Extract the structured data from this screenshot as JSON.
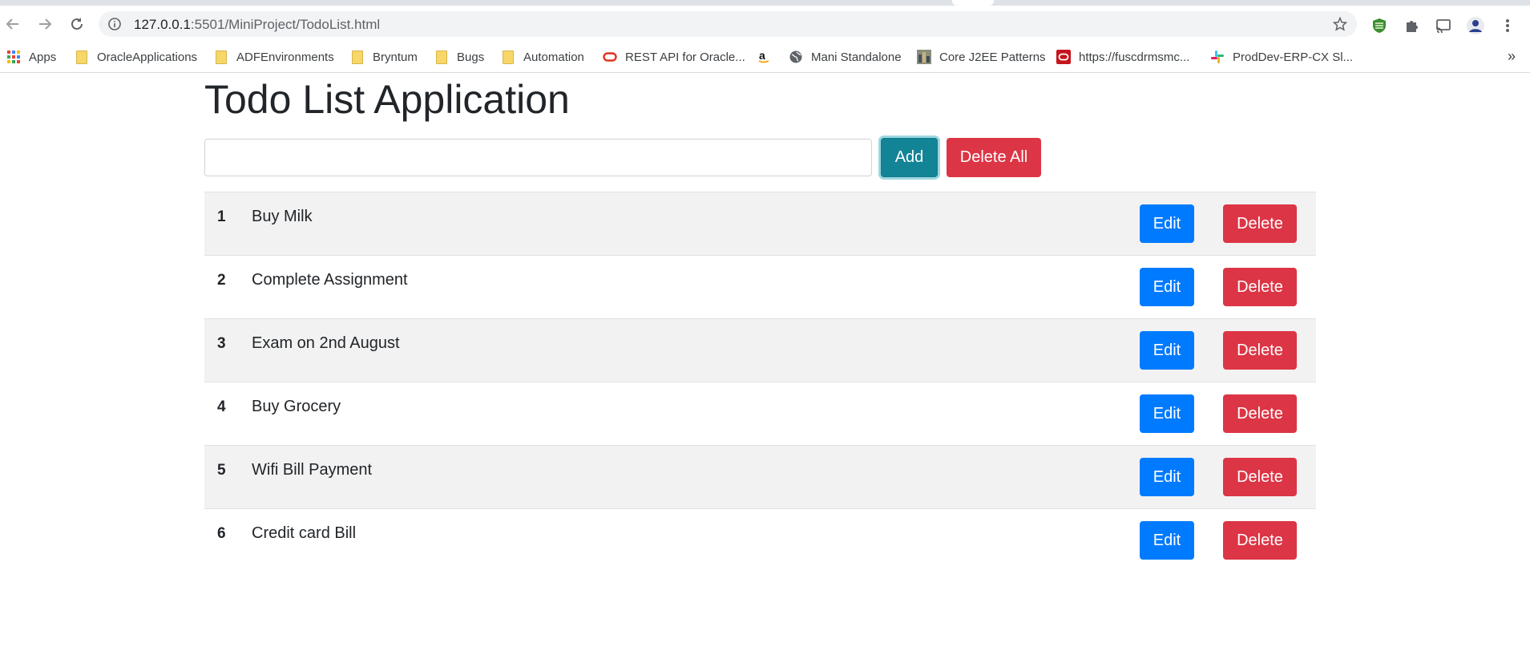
{
  "browser": {
    "url_host": "127.0.0.1",
    "url_rest": ":5501/MiniProject/TodoList.html",
    "bookmarks": [
      {
        "label": "Apps",
        "icon": "apps-grid-icon"
      },
      {
        "label": "OracleApplications",
        "icon": "folder-icon"
      },
      {
        "label": "ADFEnvironments",
        "icon": "folder-icon"
      },
      {
        "label": "Bryntum",
        "icon": "folder-icon"
      },
      {
        "label": "Bugs",
        "icon": "folder-icon"
      },
      {
        "label": "Automation",
        "icon": "folder-icon"
      },
      {
        "label": "REST API for Oracle...",
        "icon": "oracle-icon"
      },
      {
        "label": "",
        "icon": "amazon-icon"
      },
      {
        "label": "Mani Standalone",
        "icon": "globe-icon"
      },
      {
        "label": "Core J2EE Patterns",
        "icon": "image-thumb-icon"
      },
      {
        "label": "https://fuscdrmsmc...",
        "icon": "oracle-red-icon"
      },
      {
        "label": "ProdDev-ERP-CX Sl...",
        "icon": "slack-icon"
      }
    ],
    "more_label": "»"
  },
  "app": {
    "title": "Todo List Application",
    "input_value": "",
    "add_label": "Add",
    "delete_all_label": "Delete All",
    "edit_label": "Edit",
    "delete_label": "Delete",
    "todos": [
      {
        "num": "1",
        "text": "Buy Milk"
      },
      {
        "num": "2",
        "text": "Complete Assignment"
      },
      {
        "num": "3",
        "text": "Exam on 2nd August"
      },
      {
        "num": "4",
        "text": "Buy Grocery"
      },
      {
        "num": "5",
        "text": "Wifi Bill Payment"
      },
      {
        "num": "6",
        "text": "Credit card Bill"
      }
    ]
  },
  "colors": {
    "primary": "#007bff",
    "danger": "#dc3545",
    "info": "#138496",
    "stripe": "#f2f2f2"
  }
}
